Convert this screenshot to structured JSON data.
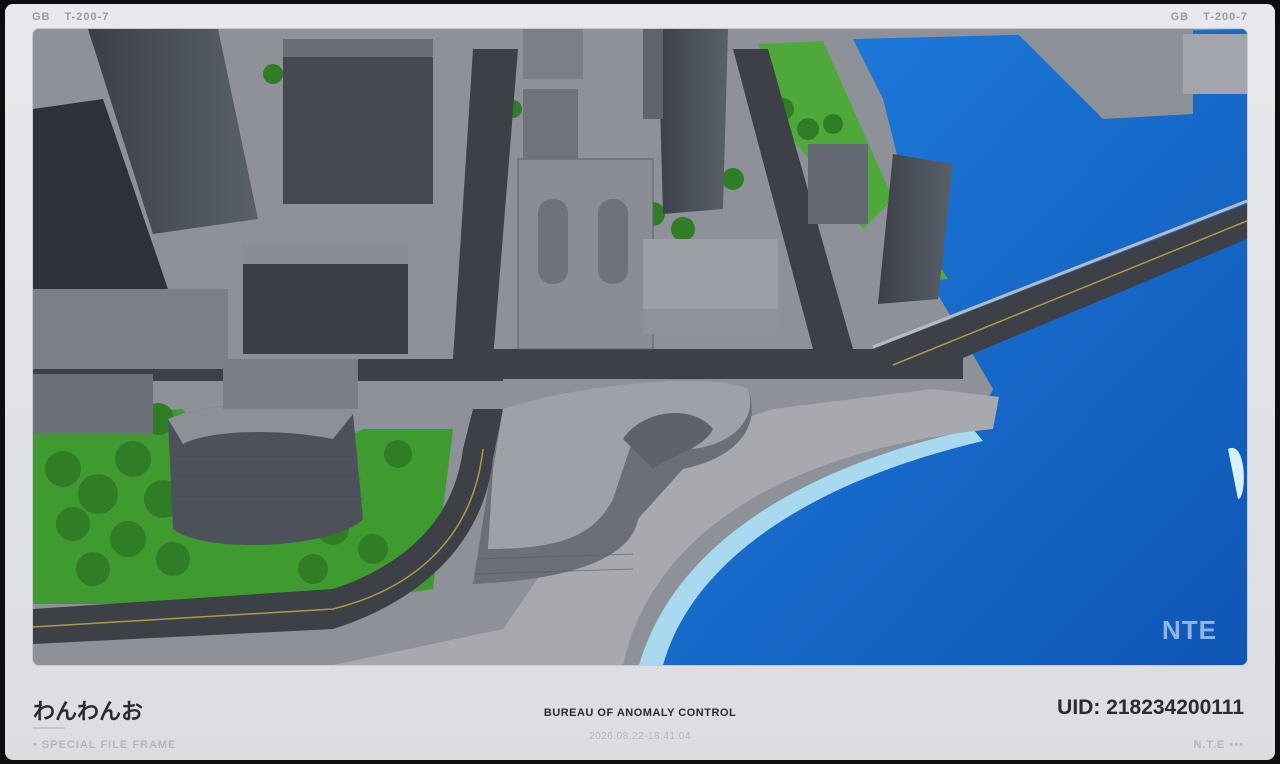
{
  "header": {
    "left": {
      "code": "GB",
      "serial": "T-200-7"
    },
    "right": {
      "code": "GB",
      "serial": "T-200-7"
    }
  },
  "watermark": {
    "logo": "NTE"
  },
  "footer": {
    "player_name": "わんわんお",
    "left_caption": "• SPECIAL FILE FRAME",
    "agency": "BUREAU OF ANOMALY CONTROL",
    "timestamp": "2026.08.22-18.41.04",
    "uid": "UID: 218234200111",
    "right_caption": "N.T.E •••"
  },
  "colors": {
    "frame": "#e3e4e7",
    "water": "#1a6fd0",
    "shore": "#bfe9f5",
    "text_dark": "#2a2b2f",
    "text_muted": "#b5b7bc"
  }
}
